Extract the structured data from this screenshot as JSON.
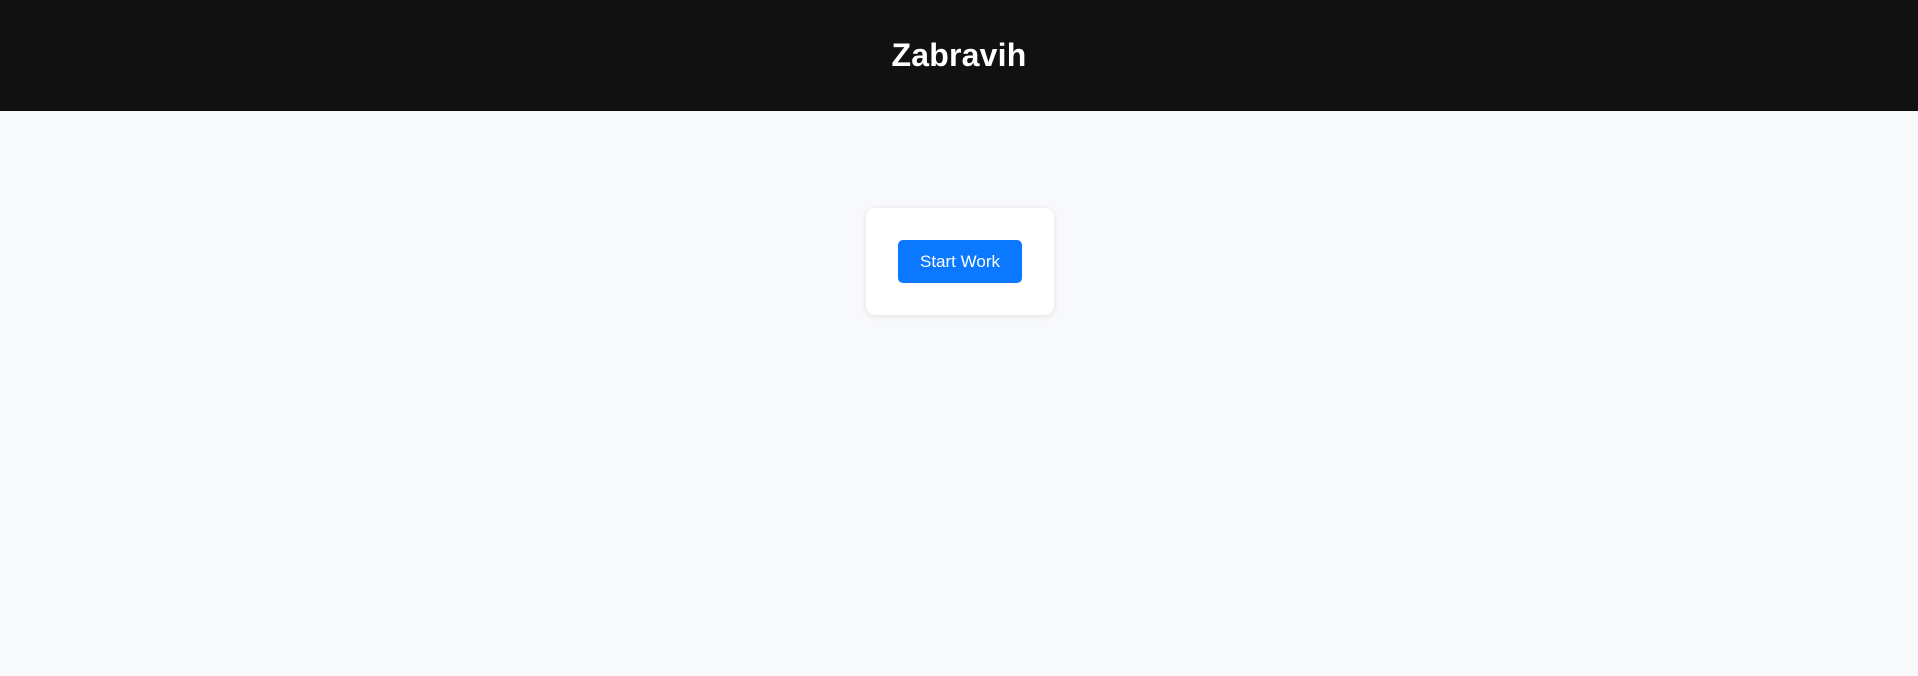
{
  "header": {
    "title": "Zabravih"
  },
  "main": {
    "card": {
      "start_button_label": "Start Work"
    }
  },
  "colors": {
    "header_bg": "#111111",
    "page_bg": "#f8f9fb",
    "card_bg": "#ffffff",
    "primary_button": "#0a78ff",
    "button_text": "#ffffff"
  }
}
